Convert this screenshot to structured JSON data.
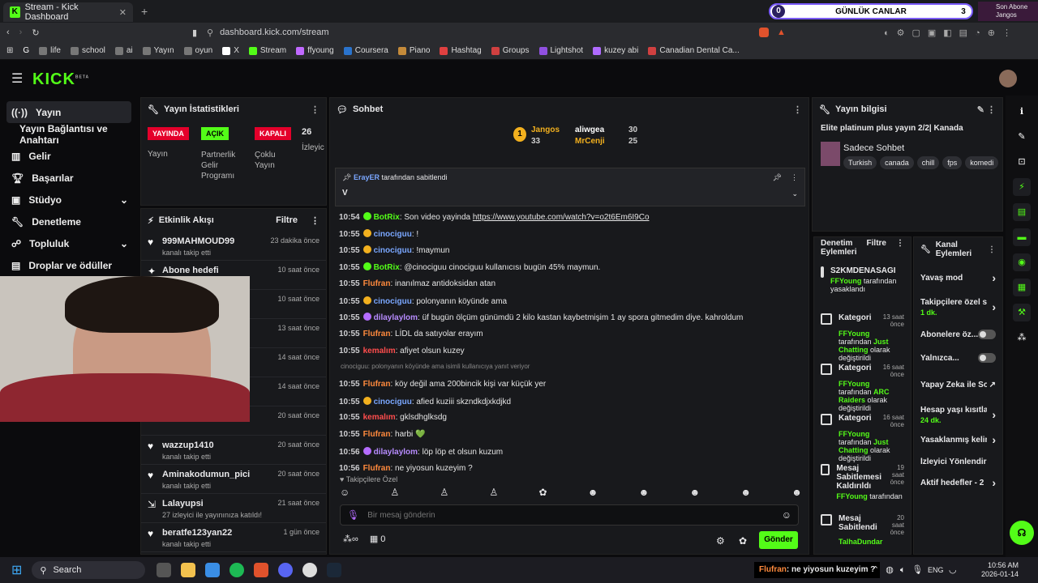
{
  "browser": {
    "tab_title": "Stream - Kick Dashboard",
    "url": "dashboard.kick.com/stream"
  },
  "overlay": {
    "left_count": "0",
    "label": "GÜNLÜK CANLAR",
    "right_count": "3",
    "sub_line1": "Son Abone",
    "sub_line2": "Jangos"
  },
  "bookmarks": [
    "life",
    "school",
    "ai",
    "Yayın",
    "oyun",
    "X",
    "Stream",
    "ffyoung",
    "Coursera",
    "Piano",
    "Hashtag",
    "Groups",
    "Lightshot",
    "kuzey abi",
    "Canadian Dental Ca..."
  ],
  "app": {
    "logo": "KICK",
    "logo_sup": "BETA"
  },
  "sidebar": {
    "items": [
      "Yayın",
      "Yayın Bağlantısı ve Anahtarı",
      "Gelir",
      "Başarılar",
      "Stüdyo",
      "Denetleme",
      "Topluluk",
      "Droplar ve ödüller"
    ]
  },
  "stats": {
    "title": "Yayın İstatistikleri",
    "b1": "YAYINDA",
    "l1": "Yayın",
    "b2": "AÇIK",
    "l2": "Partnerlik Gelir Programı",
    "b3": "KAPALI",
    "l3": "Çoklu Yayın",
    "count": "26",
    "l4": "İzleyic"
  },
  "activity": {
    "title": "Etkinlik Akışı",
    "filter": "Filtre",
    "items": [
      {
        "name": "999MAHMOUD99",
        "sub": "kanalı takip etti",
        "time": "23 dakika önce"
      },
      {
        "name": "Abone hedefi",
        "sub": "",
        "time": "10 saat önce"
      },
      {
        "name": "oldu!",
        "sub": "",
        "time": "10 saat önce"
      },
      {
        "name": "",
        "sub": "",
        "time": "13 saat önce"
      },
      {
        "name": "",
        "sub": "",
        "time": "14 saat önce"
      },
      {
        "name": "",
        "sub": "ldı!",
        "time": "14 saat önce"
      },
      {
        "name": "",
        "sub": "mesaj vurgula",
        "sub2": "alındı",
        "time": "20 saat önce"
      },
      {
        "name": "wazzup1410",
        "sub": "kanalı takip etti",
        "time": "20 saat önce"
      },
      {
        "name": "Aminakodumun_pici",
        "sub": "kanalı takip etti",
        "time": "20 saat önce"
      },
      {
        "name": "Lalayupsi",
        "sub": "27 izleyici ile yayınınıza katıldı!",
        "time": "21 saat önce"
      },
      {
        "name": "beratfe123yan22",
        "sub": "kanalı takip etti",
        "time": "1 gün önce"
      }
    ]
  },
  "chat": {
    "title": "Sohbet",
    "leader1": "Jangos",
    "leader1_n": "33",
    "leader2": "aliwgea",
    "leader2_n": "30",
    "leader3": "MrCenji",
    "leader3_n": "25",
    "pinned_by": "ErayER",
    "pinned_text": "tarafından sabitlendi",
    "pinned_msg": "V",
    "messages": [
      {
        "t": "10:54",
        "u": "BotRix",
        "c": "g",
        "m": "Son video yayinda ",
        "link": "https://www.youtube.com/watch?v=o2t6Em6I9Co"
      },
      {
        "t": "10:55",
        "u": "cinociguu",
        "c": "b",
        "m": "!"
      },
      {
        "t": "10:55",
        "u": "cinociguu",
        "c": "b",
        "m": "!maymun"
      },
      {
        "t": "10:55",
        "u": "BotRix",
        "c": "g",
        "m": "@cinociguu cinociguu kullanıcısı bugün 45% maymun."
      },
      {
        "t": "10:55",
        "u": "Flufran",
        "c": "o",
        "m": "inanılmaz antidoksidan atan"
      },
      {
        "t": "10:55",
        "u": "cinociguu",
        "c": "b",
        "m": "polonyanın köyünde ama"
      },
      {
        "t": "10:55",
        "u": "dilaylaylom",
        "c": "p",
        "m": "üf bugün ölçüm günümdü 2 kilo kastan kaybetmişim 1 ay spora gitmedim diye. kahroldum"
      },
      {
        "t": "10:55",
        "u": "Flufran",
        "c": "o",
        "m": "LİDL da satıyolar erayım"
      },
      {
        "t": "10:55",
        "u": "kemalım",
        "c": "r",
        "m": "afiyet olsun kuzey"
      },
      {
        "t": "",
        "u": "",
        "c": "",
        "m": "cinociguu: polonyanın köyünde ama isimli kullanıcıya yanıt veriyor"
      },
      {
        "t": "10:55",
        "u": "Flufran",
        "c": "o",
        "m": "köy değil ama 200bincik kişi var küçük yer"
      },
      {
        "t": "10:55",
        "u": "cinociguu",
        "c": "b",
        "m": "afied kuziii skzndkdjxkdjkd"
      },
      {
        "t": "10:55",
        "u": "kemalım",
        "c": "r",
        "m": "gklsdhglksdg"
      },
      {
        "t": "10:55",
        "u": "Flufran",
        "c": "o",
        "m": "harbi 💚"
      },
      {
        "t": "10:56",
        "u": "dilaylaylom",
        "c": "p",
        "m": "löp löp et olsun kuzum"
      },
      {
        "t": "10:56",
        "u": "Flufran",
        "c": "o",
        "m": "ne yiyosun kuzeyim ?"
      }
    ],
    "followers_only": "Takipçilere Özel",
    "placeholder": "Bir mesaj gönderin",
    "count": "0",
    "send": "Gönder"
  },
  "info": {
    "title": "Yayın bilgisi",
    "stream_title": "Elite platinum plus yayın 2/2| Kanada",
    "category": "Sadece Sohbet",
    "tags": [
      "Turkish",
      "canada",
      "chill",
      "fps",
      "komedi"
    ]
  },
  "mod": {
    "title": "Denetim Eylemleri",
    "filter": "Filtre",
    "items": [
      {
        "t": "S2KMDENASAGI",
        "s1": "FFYoung",
        "s2": "tarafından yasaklandı",
        "time": ""
      },
      {
        "t": "Kategori",
        "s1": "FFYoung",
        "s2": "tarafından",
        "s3": "Just Chatting",
        "s4": "olarak değiştirildi",
        "time": "13 saat önce"
      },
      {
        "t": "Kategori",
        "s1": "FFYoung",
        "s2": "tarafından",
        "s3": "ARC Raiders",
        "s4": "olarak değiştirildi",
        "time": "16 saat önce"
      },
      {
        "t": "Kategori",
        "s1": "FFYoung",
        "s2": "tarafından",
        "s3": "Just Chatting",
        "s4": "olarak değiştirildi",
        "time": "16 saat önce"
      },
      {
        "t": "Mesaj Sabitlemesi Kaldırıldı",
        "s1": "FFYoung",
        "s2": "tarafından",
        "time": "19 saat önce"
      },
      {
        "t": "Mesaj Sabitlendi",
        "s1": "TalhaDundar",
        "s2": "",
        "time": "20 saat önce"
      }
    ]
  },
  "channel": {
    "title": "Kanal Eylemleri",
    "items": [
      {
        "label": "Yavaş mod",
        "sub": "",
        "ctl": "chev"
      },
      {
        "label": "Takipçilere özel s",
        "sub": "1 dk.",
        "ctl": "chev"
      },
      {
        "label": "Abonelere öz...",
        "sub": "",
        "ctl": "toggle"
      },
      {
        "label": "Yalnızca...",
        "sub": "",
        "ctl": "toggle"
      },
      {
        "label": "Yapay Zeka ile Sohbet Denetimi",
        "sub": "",
        "ctl": "ext"
      },
      {
        "label": "Hesap yaşı kısıtla",
        "sub": "24 dk.",
        "ctl": "chev"
      },
      {
        "label": "Yasaklanmış kelin",
        "sub": "",
        "ctl": "chev"
      },
      {
        "label": "İzleyici Yönlendir",
        "sub": "",
        "ctl": ""
      },
      {
        "label": "Aktif hedefler - 2",
        "sub": "",
        "ctl": "chev"
      }
    ]
  },
  "taskbar": {
    "search": "Search",
    "ticker_user": "Flufran",
    "ticker_msg": ": ne yiyosun kuzeyim ?",
    "lang": "ENG",
    "time": "10:56 AM",
    "date": "2026-01-14"
  }
}
